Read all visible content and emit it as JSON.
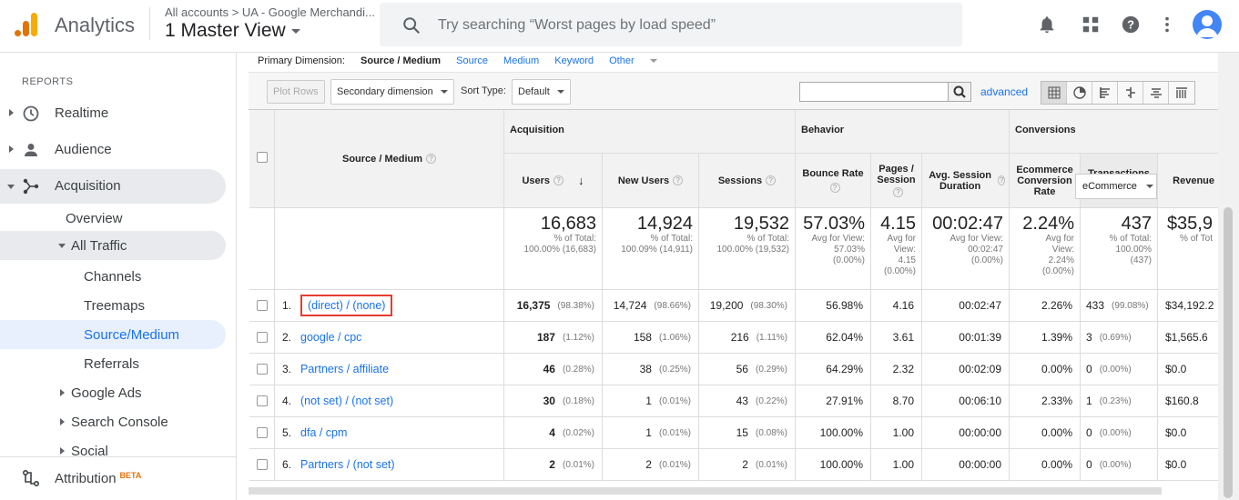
{
  "header": {
    "app_name": "Analytics",
    "account_path": "All accounts  >  UA - Google Merchandi...",
    "view_name": "1 Master View",
    "search_placeholder": "Try searching “Worst pages by load speed”"
  },
  "sidebar": {
    "section_title": "REPORTS",
    "items": [
      {
        "label": "Realtime"
      },
      {
        "label": "Audience"
      },
      {
        "label": "Acquisition"
      },
      {
        "label": "Overview"
      },
      {
        "label": "All Traffic"
      },
      {
        "label": "Channels"
      },
      {
        "label": "Treemaps"
      },
      {
        "label": "Source/Medium"
      },
      {
        "label": "Referrals"
      },
      {
        "label": "Google Ads"
      },
      {
        "label": "Search Console"
      },
      {
        "label": "Social"
      }
    ],
    "attribution": {
      "label": "Attribution",
      "badge": "BETA"
    }
  },
  "primary_dimension": {
    "label": "Primary Dimension:",
    "current": "Source / Medium",
    "options": [
      "Source",
      "Medium",
      "Keyword",
      "Other"
    ]
  },
  "toolbar": {
    "plot_rows": "Plot Rows",
    "secondary_dimension": "Secondary dimension",
    "sort_type_label": "Sort Type:",
    "sort_type_value": "Default",
    "advanced": "advanced"
  },
  "table": {
    "dimension_header": "Source / Medium",
    "groups": {
      "acquisition": "Acquisition",
      "behavior": "Behavior",
      "conversions": "Conversions",
      "conversions_select": "eCommerce"
    },
    "columns": [
      "Users",
      "New Users",
      "Sessions",
      "Bounce Rate",
      "Pages / Session",
      "Avg. Session Duration",
      "Ecommerce Conversion Rate",
      "Transactions",
      "Revenue"
    ],
    "totals": [
      {
        "big": "16,683",
        "l1": "% of Total:",
        "l2": "100.00% (16,683)",
        "l3": "",
        "l4": ""
      },
      {
        "big": "14,924",
        "l1": "% of Total:",
        "l2": "100.09% (14,911)",
        "l3": "",
        "l4": ""
      },
      {
        "big": "19,532",
        "l1": "% of Total:",
        "l2": "100.00% (19,532)",
        "l3": "",
        "l4": ""
      },
      {
        "big": "57.03%",
        "l1": "Avg for View:",
        "l2": "57.03%",
        "l3": "(0.00%)",
        "l4": ""
      },
      {
        "big": "4.15",
        "l1": "Avg for",
        "l2": "View:",
        "l3": "4.15",
        "l4": "(0.00%)"
      },
      {
        "big": "00:02:47",
        "l1": "Avg for View:",
        "l2": "00:02:47",
        "l3": "(0.00%)",
        "l4": ""
      },
      {
        "big": "2.24%",
        "l1": "Avg for",
        "l2": "View:",
        "l3": "2.24%",
        "l4": "(0.00%)"
      },
      {
        "big": "437",
        "l1": "% of Total:",
        "l2": "100.00%",
        "l3": "(437)",
        "l4": ""
      },
      {
        "big": "$35,9",
        "l1": "% of Tot",
        "l2": "",
        "l3": "",
        "l4": ""
      }
    ],
    "rows": [
      {
        "idx": "1.",
        "source": "(direct) / (none)",
        "users": "16,375",
        "users_pct": "(98.38%)",
        "new_users": "14,724",
        "new_users_pct": "(98.66%)",
        "sessions": "19,200",
        "sessions_pct": "(98.30%)",
        "bounce": "56.98%",
        "pps": "4.16",
        "dur": "00:02:47",
        "ecr": "2.26%",
        "trans": "433",
        "trans_pct": "(99.08%)",
        "rev": "$34,192.2"
      },
      {
        "idx": "2.",
        "source": "google / cpc",
        "users": "187",
        "users_pct": "(1.12%)",
        "new_users": "158",
        "new_users_pct": "(1.06%)",
        "sessions": "216",
        "sessions_pct": "(1.11%)",
        "bounce": "62.04%",
        "pps": "3.61",
        "dur": "00:01:39",
        "ecr": "1.39%",
        "trans": "3",
        "trans_pct": "(0.69%)",
        "rev": "$1,565.6"
      },
      {
        "idx": "3.",
        "source": "Partners / affiliate",
        "users": "46",
        "users_pct": "(0.28%)",
        "new_users": "38",
        "new_users_pct": "(0.25%)",
        "sessions": "56",
        "sessions_pct": "(0.29%)",
        "bounce": "64.29%",
        "pps": "2.32",
        "dur": "00:02:09",
        "ecr": "0.00%",
        "trans": "0",
        "trans_pct": "(0.00%)",
        "rev": "$0.0"
      },
      {
        "idx": "4.",
        "source": "(not set) / (not set)",
        "users": "30",
        "users_pct": "(0.18%)",
        "new_users": "1",
        "new_users_pct": "(0.01%)",
        "sessions": "43",
        "sessions_pct": "(0.22%)",
        "bounce": "27.91%",
        "pps": "8.70",
        "dur": "00:06:10",
        "ecr": "2.33%",
        "trans": "1",
        "trans_pct": "(0.23%)",
        "rev": "$160.8"
      },
      {
        "idx": "5.",
        "source": "dfa / cpm",
        "users": "4",
        "users_pct": "(0.02%)",
        "new_users": "1",
        "new_users_pct": "(0.01%)",
        "sessions": "15",
        "sessions_pct": "(0.08%)",
        "bounce": "100.00%",
        "pps": "1.00",
        "dur": "00:00:00",
        "ecr": "0.00%",
        "trans": "0",
        "trans_pct": "(0.00%)",
        "rev": "$0.0"
      },
      {
        "idx": "6.",
        "source": "Partners / (not set)",
        "users": "2",
        "users_pct": "(0.01%)",
        "new_users": "2",
        "new_users_pct": "(0.01%)",
        "sessions": "2",
        "sessions_pct": "(0.01%)",
        "bounce": "100.00%",
        "pps": "1.00",
        "dur": "00:00:00",
        "ecr": "0.00%",
        "trans": "0",
        "trans_pct": "(0.00%)",
        "rev": "$0.0"
      }
    ]
  },
  "colors": {
    "accent": "#1a73e8",
    "highlight": "#e53d2f",
    "logo_orange": "#f9ab00",
    "logo_dark": "#e37400"
  }
}
